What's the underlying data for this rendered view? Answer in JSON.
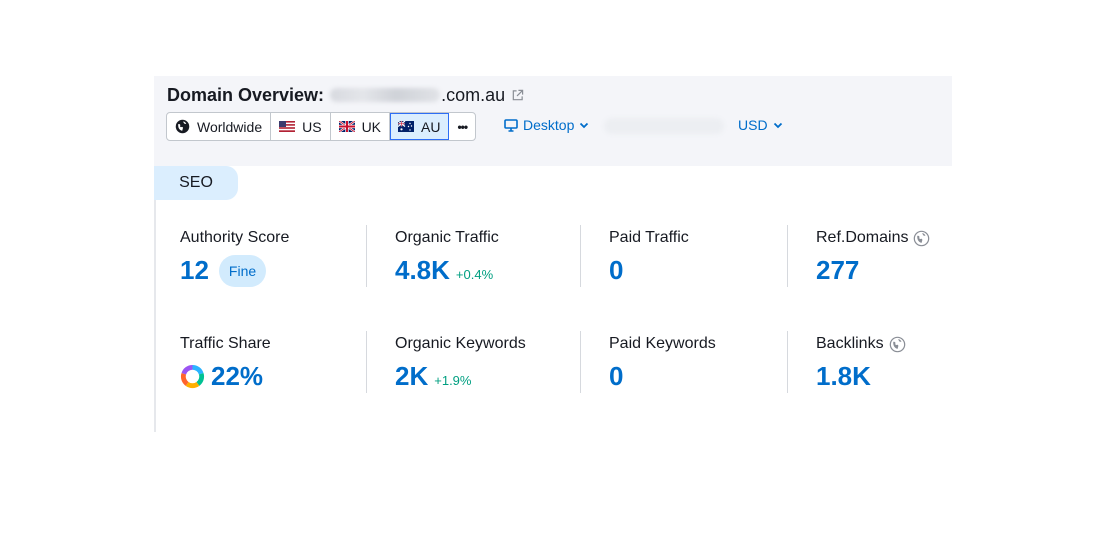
{
  "header": {
    "title": "Domain Overview:",
    "domain_suffix": ".com.au"
  },
  "regions": [
    {
      "label": "Worldwide"
    },
    {
      "label": "US"
    },
    {
      "label": "UK"
    },
    {
      "label": "AU",
      "active": true
    }
  ],
  "more_label": "•••",
  "device": {
    "label": "Desktop"
  },
  "currency": {
    "label": "USD"
  },
  "tabs": {
    "seo": "SEO"
  },
  "metrics": {
    "authority_score": {
      "label": "Authority Score",
      "value": "12",
      "badge": "Fine"
    },
    "organic_traffic": {
      "label": "Organic Traffic",
      "value": "4.8K",
      "delta": "+0.4%"
    },
    "paid_traffic": {
      "label": "Paid Traffic",
      "value": "0"
    },
    "ref_domains": {
      "label": "Ref.Domains",
      "value": "277"
    },
    "traffic_share": {
      "label": "Traffic Share",
      "value": "22%"
    },
    "organic_keywords": {
      "label": "Organic Keywords",
      "value": "2K",
      "delta": "+1.9%"
    },
    "paid_keywords": {
      "label": "Paid Keywords",
      "value": "0"
    },
    "backlinks": {
      "label": "Backlinks",
      "value": "1.8K"
    }
  },
  "colors": {
    "accent": "#006dca",
    "positive": "#009f81",
    "header_bg": "#f4f5f9",
    "tab_bg": "#dbeefe"
  }
}
